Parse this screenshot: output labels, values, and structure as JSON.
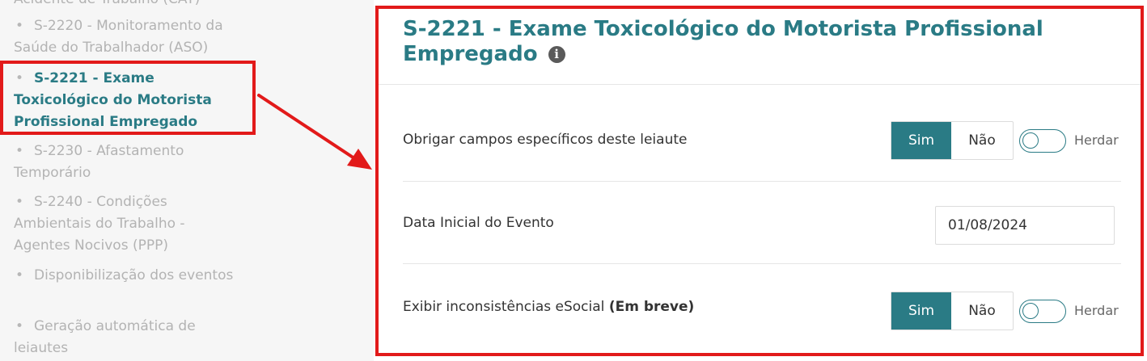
{
  "sidebar": {
    "items": [
      {
        "label": "Acidente de Trabalho (CAT)",
        "bullet": false
      },
      {
        "label": "S-2220 - Monitoramento da Saúde do Trabalhador (ASO)",
        "bullet": true
      },
      {
        "label": "S-2221 - Exame Toxicológico do Motorista Profissional Empregado",
        "bullet": true,
        "active": true
      },
      {
        "label": "S-2230 - Afastamento Temporário",
        "bullet": true
      },
      {
        "label": "S-2240 - Condições Ambientais do Trabalho - Agentes Nocivos (PPP)",
        "bullet": true
      },
      {
        "label": "Disponibilização dos eventos",
        "bullet": true
      },
      {
        "label": "Geração automática de leiautes",
        "bullet": true
      }
    ]
  },
  "panel": {
    "title": "S-2221 - Exame Toxicológico do Motorista Profissional Empregado",
    "info_icon": "info-circle-icon",
    "rows": [
      {
        "label": "Obrigar campos específicos deste leiaute",
        "options": [
          "Sim",
          "Não"
        ],
        "selected": "Sim",
        "inherit_label": "Herdar",
        "inherit_on": false
      },
      {
        "label": "Data Inicial do Evento",
        "value": "01/08/2024"
      },
      {
        "label": "Exibir inconsistências eSocial",
        "label_suffix": "(Em breve)",
        "options": [
          "Sim",
          "Não"
        ],
        "selected": "Sim",
        "inherit_label": "Herdar",
        "inherit_on": false
      }
    ]
  },
  "colors": {
    "accent": "#2a7b85",
    "highlight": "#e21a1a",
    "muted_text": "#b3b3b3"
  }
}
